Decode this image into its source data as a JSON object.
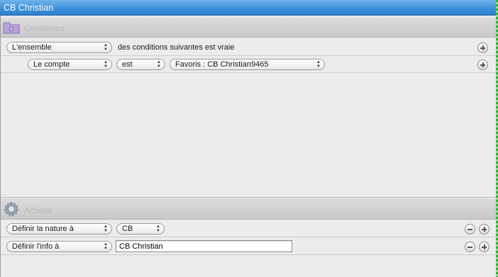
{
  "window": {
    "title": "CB Christian"
  },
  "conditions": {
    "header": "Conditions",
    "match_rule": {
      "selected": "L'ensemble",
      "suffix": "des conditions suivantes est vraie"
    },
    "rules": [
      {
        "field": "Le compte",
        "operator": "est",
        "value": "Favoris : CB Christian9465"
      }
    ]
  },
  "actions": {
    "header": "Actions",
    "rows": [
      {
        "action": "Définir la nature à",
        "value": "CB"
      },
      {
        "action": "Définir l'info à",
        "value": "CB Christian"
      }
    ]
  },
  "colors": {
    "titlebar": "#3a8fd9",
    "header_text": "#b7b7b7",
    "accent_green": "#2eb12e"
  }
}
